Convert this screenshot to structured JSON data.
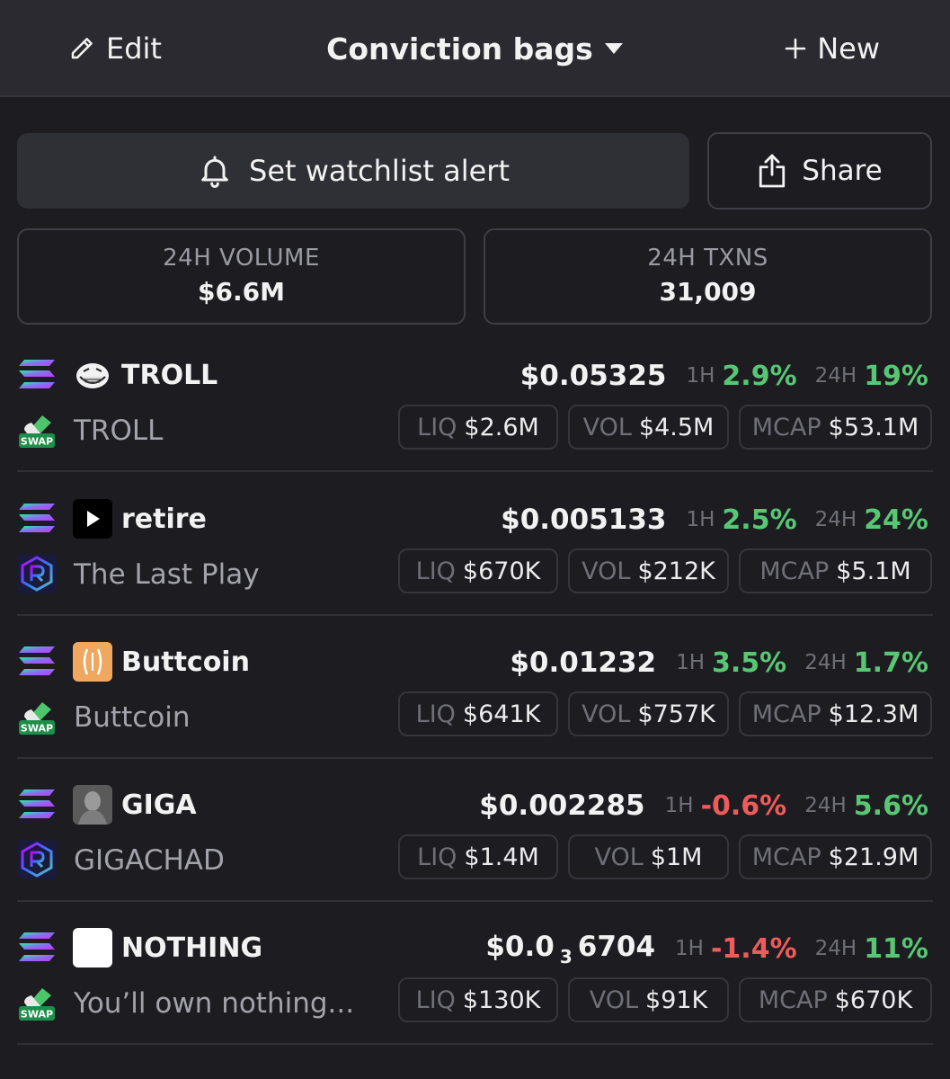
{
  "header": {
    "edit_label": "Edit",
    "title": "Conviction bags",
    "new_label": "New"
  },
  "actions": {
    "alert_label": "Set watchlist alert",
    "share_label": "Share"
  },
  "stats": {
    "volume_label": "24H VOLUME",
    "volume_value": "$6.6M",
    "txns_label": "24H TXNS",
    "txns_value": "31,009"
  },
  "labels": {
    "h1": "1H",
    "h24": "24H",
    "liq": "LIQ",
    "vol": "VOL",
    "mcap": "MCAP",
    "swap_badge": "SWAP"
  },
  "tokens": [
    {
      "symbol": "TROLL",
      "name": "TROLL",
      "price": "$0.05325",
      "change_1h": "2.9%",
      "change_24h": "19%",
      "liq": "$2.6M",
      "vol": "$4.5M",
      "mcap": "$53.1M",
      "dex_icon": "swap-icon",
      "avatar_icon": "trollface-icon"
    },
    {
      "symbol": "retire",
      "name": "The Last Play",
      "price": "$0.005133",
      "change_1h": "2.5%",
      "change_24h": "24%",
      "liq": "$670K",
      "vol": "$212K",
      "mcap": "$5.1M",
      "dex_icon": "raydium-icon",
      "avatar_icon": "play-icon"
    },
    {
      "symbol": "Buttcoin",
      "name": "Buttcoin",
      "price": "$0.01232",
      "change_1h": "3.5%",
      "change_24h": "1.7%",
      "liq": "$641K",
      "vol": "$757K",
      "mcap": "$12.3M",
      "dex_icon": "swap-icon",
      "avatar_icon": "buttcoin-icon"
    },
    {
      "symbol": "GIGA",
      "name": "GIGACHAD",
      "price": "$0.002285",
      "change_1h": "-0.6%",
      "change_24h": "5.6%",
      "liq": "$1.4M",
      "vol": "$1M",
      "mcap": "$21.9M",
      "dex_icon": "raydium-icon",
      "avatar_icon": "gigachad-icon"
    },
    {
      "symbol": "NOTHING",
      "name": "You’ll own nothing...",
      "price_prefix": "$0.0",
      "price_sub": "3",
      "price_rest": "6704",
      "change_1h": "-1.4%",
      "change_24h": "11%",
      "liq": "$130K",
      "vol": "$91K",
      "mcap": "$670K",
      "dex_icon": "swap-icon",
      "avatar_icon": "blank-square-icon"
    }
  ],
  "colors": {
    "background": "#1c1c21",
    "header_bg": "#2a2a30",
    "positive": "#58c774",
    "negative": "#ef5b5b",
    "muted": "#6f6f78"
  }
}
